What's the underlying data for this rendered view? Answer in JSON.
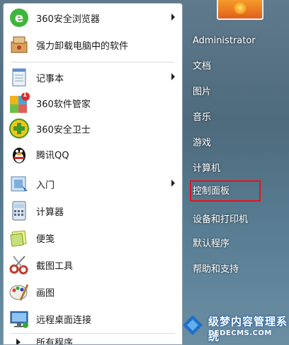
{
  "left_items": [
    {
      "label": "360安全浏览器",
      "icon": "360-browser-icon",
      "submenu": true
    },
    {
      "label": "强力卸载电脑中的软件",
      "icon": "uninstall-icon",
      "submenu": false
    },
    {
      "label": "记事本",
      "icon": "notepad-icon",
      "submenu": true
    },
    {
      "label": "360软件管家",
      "icon": "360-software-manager-icon",
      "submenu": false,
      "badge": "1"
    },
    {
      "label": "360安全卫士",
      "icon": "360-security-guard-icon",
      "submenu": false
    },
    {
      "label": "腾讯QQ",
      "icon": "qq-penguin-icon",
      "submenu": false
    },
    {
      "label": "入门",
      "icon": "getting-started-icon",
      "submenu": true
    },
    {
      "label": "计算器",
      "icon": "calculator-icon",
      "submenu": false
    },
    {
      "label": "便笺",
      "icon": "sticky-notes-icon",
      "submenu": false
    },
    {
      "label": "截图工具",
      "icon": "snipping-tool-icon",
      "submenu": false
    },
    {
      "label": "画图",
      "icon": "paint-icon",
      "submenu": false
    },
    {
      "label": "远程桌面连接",
      "icon": "remote-desktop-icon",
      "submenu": false
    },
    {
      "label": "所有程序",
      "icon": "all-programs-arrow-icon",
      "submenu": false
    }
  ],
  "right_items": [
    "Administrator",
    "文档",
    "图片",
    "音乐",
    "游戏",
    "计算机",
    "控制面板",
    "设备和打印机",
    "默认程序",
    "帮助和支持"
  ],
  "highlighted_item": "控制面板",
  "watermark": {
    "title": "级梦内容管理系统",
    "url": "DEDECMS.COM"
  },
  "colors": {
    "highlight_border": "#e0161c",
    "right_text": "#ffffff",
    "panel_bg": "#ffffff"
  }
}
